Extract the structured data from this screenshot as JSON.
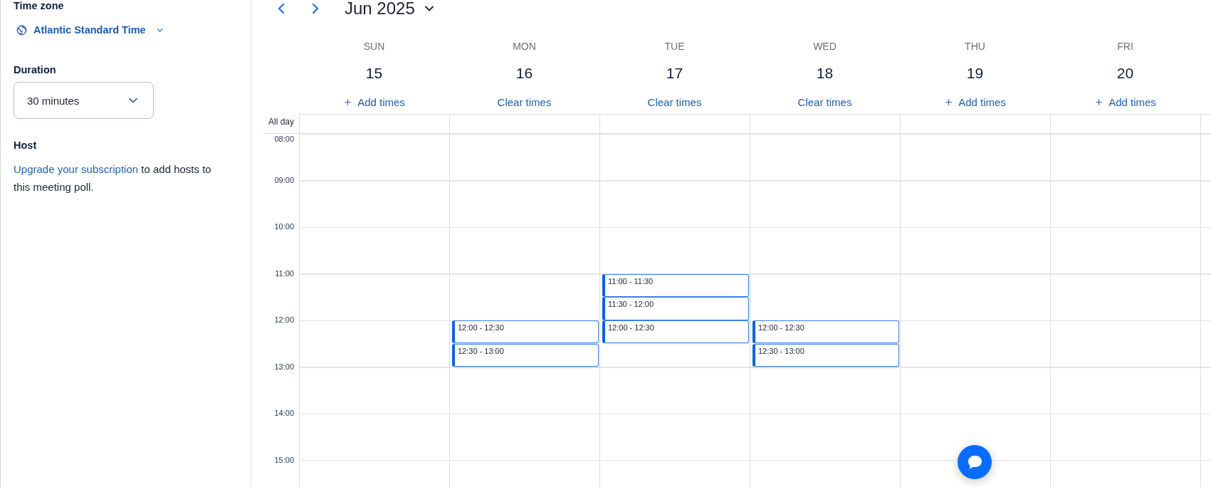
{
  "sidebar": {
    "time_zone": {
      "label": "Time zone",
      "value": "Atlantic Standard Time"
    },
    "duration": {
      "label": "Duration",
      "value": "30 minutes"
    },
    "host": {
      "label": "Host",
      "link": "Upgrade your subscription",
      "text": "to add hosts to this meeting poll."
    }
  },
  "calendar": {
    "month": "Jun 2025",
    "all_day_label": "All day",
    "hours": [
      "08:00",
      "09:00",
      "10:00",
      "11:00",
      "12:00",
      "13:00",
      "14:00",
      "15:00"
    ],
    "days": [
      {
        "name": "SUN",
        "date": "15",
        "action": {
          "kind": "add",
          "label": "Add times"
        }
      },
      {
        "name": "MON",
        "date": "16",
        "action": {
          "kind": "clear",
          "label": "Clear times"
        },
        "slots": [
          "12:00 - 12:30",
          "12:30 - 13:00"
        ]
      },
      {
        "name": "TUE",
        "date": "17",
        "action": {
          "kind": "clear",
          "label": "Clear times"
        },
        "slots": [
          "11:00 - 11:30",
          "11:30 - 12:00",
          "12:00 - 12:30"
        ]
      },
      {
        "name": "WED",
        "date": "18",
        "action": {
          "kind": "clear",
          "label": "Clear times"
        },
        "slots": [
          "12:00 - 12:30",
          "12:30 - 13:00"
        ]
      },
      {
        "name": "THU",
        "date": "19",
        "action": {
          "kind": "add",
          "label": "Add times"
        }
      },
      {
        "name": "FRI",
        "date": "20",
        "action": {
          "kind": "add",
          "label": "Add times"
        }
      }
    ]
  }
}
